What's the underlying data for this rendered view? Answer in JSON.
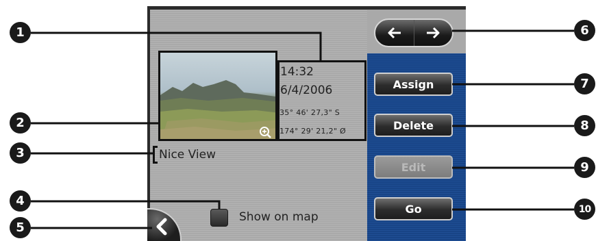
{
  "photo": {
    "zoom_icon": "magnifier-plus-icon"
  },
  "info": {
    "time": "14:32",
    "date": "6/4/2006",
    "latitude": "35° 46' 27,3\" S",
    "longitude": "174° 29' 21,2\" Ø"
  },
  "name_label": "Nice View",
  "show_on_map": {
    "label": "Show on map",
    "checked": false
  },
  "nav": {
    "back_icon": "chevron-left-icon",
    "prev_icon": "arrow-left-icon",
    "next_icon": "arrow-right-icon"
  },
  "buttons": {
    "assign": "Assign",
    "delete": "Delete",
    "edit": "Edit",
    "go": "Go"
  },
  "callouts": [
    "1",
    "2",
    "3",
    "4",
    "5",
    "6",
    "7",
    "8",
    "9",
    "10"
  ],
  "colors": {
    "side_panel": "#1f4f95",
    "main_panel": "#b0b0b0",
    "callout": "#1a1a1a"
  }
}
